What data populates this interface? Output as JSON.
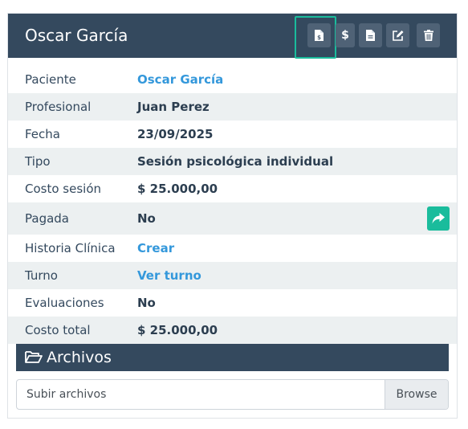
{
  "card": {
    "title": "Oscar García",
    "actions": [
      {
        "name": "invoice-button",
        "icon": "file-invoice-icon"
      },
      {
        "name": "payment-button",
        "icon": "dollar-icon",
        "text": "$"
      },
      {
        "name": "document-button",
        "icon": "file-text-icon"
      },
      {
        "name": "edit-button",
        "icon": "edit-icon"
      },
      {
        "name": "delete-button",
        "icon": "trash-icon"
      }
    ]
  },
  "details": [
    {
      "label": "Paciente",
      "value": "Oscar García",
      "link": true
    },
    {
      "label": "Profesional",
      "value": "Juan Perez"
    },
    {
      "label": "Fecha",
      "value": "23/09/2025"
    },
    {
      "label": "Tipo",
      "value": "Sesión psicológica individual"
    },
    {
      "label": "Costo sesión",
      "value": "$ 25.000,00"
    },
    {
      "label": "Pagada",
      "value": "No",
      "action_icon": "share-icon"
    },
    {
      "label": "Historia Clínica",
      "value": "Crear",
      "link": true
    },
    {
      "label": "Turno",
      "value": "Ver turno",
      "link": true
    },
    {
      "label": "Evaluaciones",
      "value": "No"
    },
    {
      "label": "Costo total",
      "value": "$ 25.000,00"
    }
  ],
  "files": {
    "title": "Archivos",
    "icon": "folder-open-icon",
    "input_placeholder": "Subir archivos",
    "browse_label": "Browse"
  },
  "colors": {
    "header_bg": "#34495e",
    "accent": "#1abc9c",
    "link": "#3498db",
    "row_alt": "#ecf0f1"
  }
}
